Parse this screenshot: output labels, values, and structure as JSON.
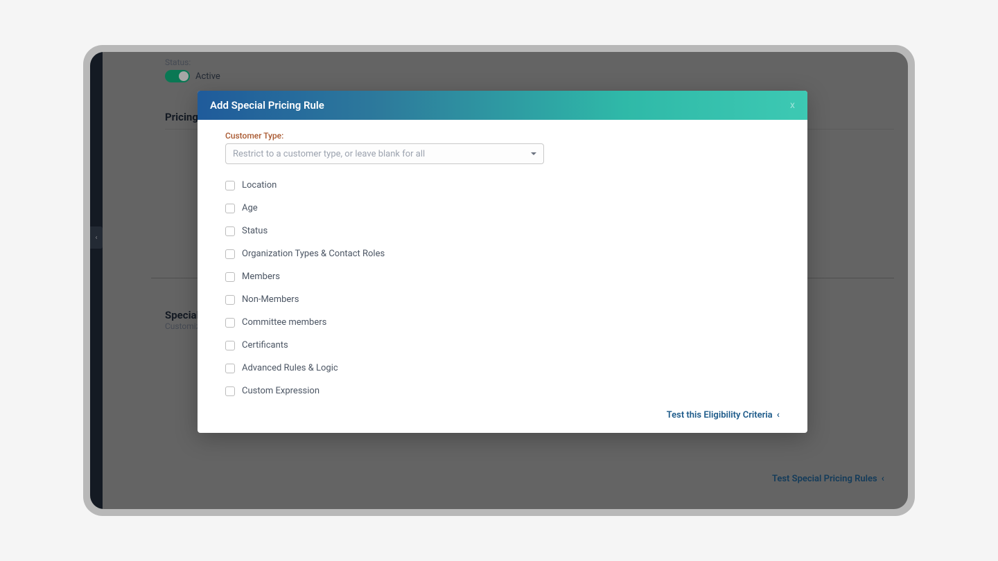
{
  "status": {
    "label": "Status:",
    "value": "Active"
  },
  "sections": {
    "pricing_title": "Pricing",
    "special_title": "Special Pri",
    "special_sub": "Customize sp",
    "test_rules": "Test Special Pricing Rules"
  },
  "modal": {
    "title": "Add Special Pricing Rule",
    "close": "x",
    "customer_type_label": "Customer Type:",
    "customer_type_placeholder": "Restrict to a customer type, or leave blank for all",
    "checkboxes": [
      "Location",
      "Age",
      "Status",
      "Organization Types & Contact Roles",
      "Members",
      "Non-Members",
      "Committee members",
      "Certificants",
      "Advanced Rules & Logic",
      "Custom Expression"
    ],
    "test_eligibility": "Test this Eligibility Criteria"
  }
}
